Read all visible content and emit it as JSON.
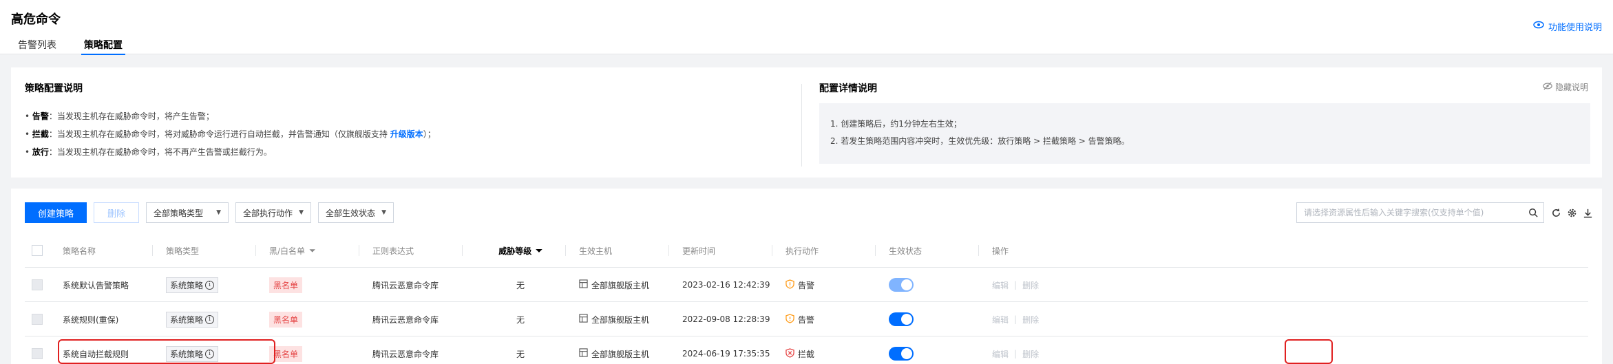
{
  "header": {
    "title": "高危命令",
    "tabs": [
      {
        "label": "告警列表",
        "active": false
      },
      {
        "label": "策略配置",
        "active": true
      }
    ],
    "help_link": "功能使用说明"
  },
  "intro": {
    "title": "策略配置说明",
    "lines": [
      {
        "term": "告警",
        "text": "：当发现主机存在威胁命令时，将产生告警；"
      },
      {
        "term": "拦截",
        "text": "：当发现主机存在威胁命令时，将对威胁命令运行进行自动拦截，并告警通知（仅旗舰版支持 ",
        "link": "升级版本",
        "tail": "）；"
      },
      {
        "term": "放行",
        "text": "：当发现主机存在威胁命令时，将不再产生告警或拦截行为。"
      }
    ],
    "detail_title": "配置详情说明",
    "detail_lines": [
      "1. 创建策略后，约1分钟左右生效；",
      "2. 若发生策略范围内容冲突时，生效优先级：放行策略 > 拦截策略 > 告警策略。"
    ],
    "hide_label": "隐藏说明"
  },
  "toolbar": {
    "create_label": "创建策略",
    "delete_label": "删除",
    "filters": [
      "全部策略类型",
      "全部执行动作",
      "全部生效状态"
    ],
    "search_placeholder": "请选择资源属性后输入关键字搜索(仅支持单个值)"
  },
  "table": {
    "headers": {
      "name": "策略名称",
      "type": "策略类型",
      "list": "黑/白名单",
      "regex": "正则表达式",
      "level": "威胁等级",
      "host": "生效主机",
      "updated": "更新时间",
      "action": "执行动作",
      "status": "生效状态",
      "ops": "操作"
    },
    "rows": [
      {
        "name": "系统默认告警策略",
        "type": "系统策略",
        "list": "黑名单",
        "regex": "腾讯云恶意命令库",
        "level": "无",
        "host": "全部旗舰版主机",
        "updated": "2023-02-16 12:42:39",
        "action": "告警",
        "status_on": true,
        "op_edit": "编辑",
        "op_delete": "删除"
      },
      {
        "name": "系统规则(重保)",
        "type": "系统策略",
        "list": "黑名单",
        "regex": "腾讯云恶意命令库",
        "level": "无",
        "host": "全部旗舰版主机",
        "updated": "2022-09-08 12:28:39",
        "action": "告警",
        "status_on": true,
        "op_edit": "编辑",
        "op_delete": "删除"
      },
      {
        "name": "系统自动拦截规则",
        "type": "系统策略",
        "list": "黑名单",
        "regex": "腾讯云恶意命令库",
        "level": "无",
        "host": "全部旗舰版主机",
        "updated": "2024-06-19 17:35:35",
        "action": "拦截",
        "status_on": true,
        "op_edit": "编辑",
        "op_delete": "删除"
      }
    ]
  },
  "colors": {
    "accent": "#006eff",
    "danger": "#e54545",
    "warning": "#ff9c19",
    "highlight": "#e02020"
  }
}
